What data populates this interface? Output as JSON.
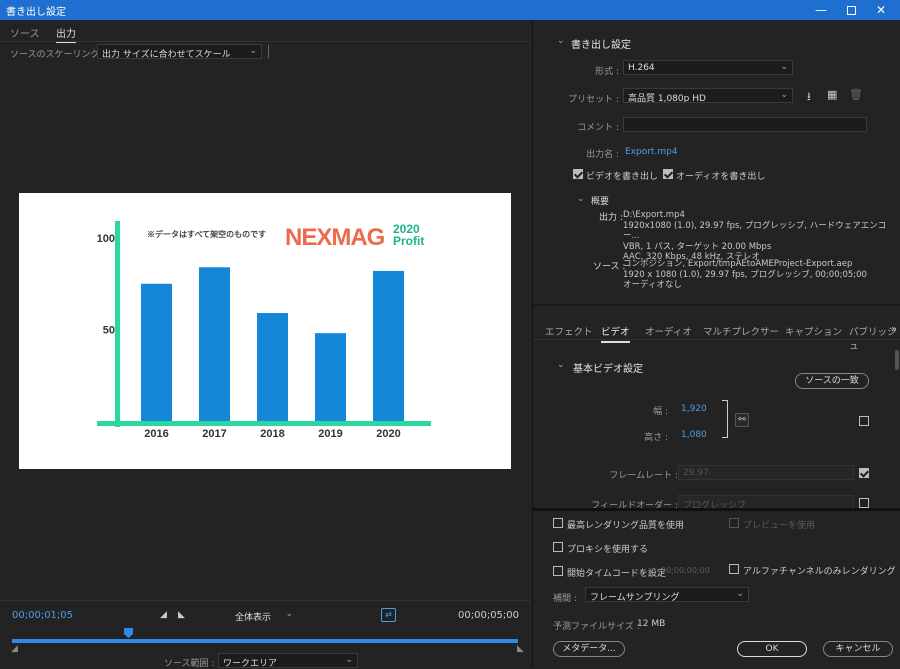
{
  "window": {
    "title": "書き出し設定"
  },
  "left": {
    "tabs": [
      {
        "label": "ソース"
      },
      {
        "label": "出力"
      }
    ],
    "scaling": {
      "label": "ソースのスケーリング :",
      "value": "出力 サイズに合わせてスケール"
    },
    "preview": {
      "note": "※データはすべて架空のものです",
      "logo": "NEXMAG",
      "logo_year": "2020",
      "logo_sub": "Profit"
    },
    "timeline": {
      "current": "00;00;01;05",
      "end": "00;00;05;00",
      "zoom": "全体表示",
      "range_label": "ソース範囲 :",
      "range_value": "ワークエリア"
    }
  },
  "chart_data": {
    "type": "bar",
    "categories": [
      "2016",
      "2017",
      "2018",
      "2019",
      "2020"
    ],
    "values": [
      75,
      84,
      59,
      48,
      82
    ],
    "yticks": [
      50,
      100
    ],
    "ylim": [
      0,
      100
    ],
    "colors": {
      "bar": "#1587d9",
      "axis": "#2ed6a0"
    }
  },
  "right": {
    "export_settings": {
      "title": "書き出し設定",
      "format_label": "形式 :",
      "format_value": "H.264",
      "preset_label": "プリセット :",
      "preset_value": "高品質 1,080p HD",
      "comment_label": "コメント :",
      "comment_value": "",
      "output_name_label": "出力名 :",
      "output_name_value": "Export.mp4",
      "export_video_label": "ビデオを書き出し",
      "export_video_checked": true,
      "export_audio_label": "オーディオを書き出し",
      "export_audio_checked": true
    },
    "summary": {
      "title": "概要",
      "output_label": "出力 :",
      "output_lines": [
        "D:\\Export.mp4",
        "1920x1080 (1.0), 29.97 fps, プログレッシブ, ハードウェアエンコー...",
        "VBR, 1 パス, ターゲット 20.00 Mbps",
        "AAC, 320 Kbps, 48 kHz, ステレオ"
      ],
      "source_label": "ソース :",
      "source_lines": [
        "コンポジション, Export/tmpAEtoAMEProject-Export.aep",
        "1920 x 1080 (1.0), 29.97 fps, プログレッシブ, 00;00;05;00",
        "オーディオなし"
      ]
    },
    "tabs": [
      {
        "label": "エフェクト"
      },
      {
        "label": "ビデオ"
      },
      {
        "label": "オーディオ"
      },
      {
        "label": "マルチプレクサー"
      },
      {
        "label": "キャプション"
      },
      {
        "label": "パブリッシュ"
      }
    ],
    "tabs_more": "»",
    "basic_video": {
      "title": "基本ビデオ設定",
      "match_source": "ソースの一致",
      "width_label": "幅 :",
      "width_value": "1,920",
      "height_label": "高さ :",
      "height_value": "1,080",
      "framerate_label": "フレームレート :",
      "framerate_value": "29.97",
      "field_order_label": "フィールドオーダー :",
      "field_order_value": "プログレッシブ"
    },
    "bottom": {
      "max_render_quality": "最高レンダリング品質を使用",
      "use_preview": "プレビューを使用",
      "use_proxy": "プロキシを使用する",
      "start_timecode": "開始タイムコードを設定",
      "start_timecode_value": "00;00;00;00",
      "alpha_only": "アルファチャンネルのみレンダリング",
      "interp_label": "補間 :",
      "interp_value": "フレームサンプリング",
      "file_size_label": "予測ファイルサイズ :",
      "file_size_value": "12 MB",
      "metadata_button": "メタデータ...",
      "ok_button": "OK",
      "cancel_button": "キャンセル"
    }
  }
}
